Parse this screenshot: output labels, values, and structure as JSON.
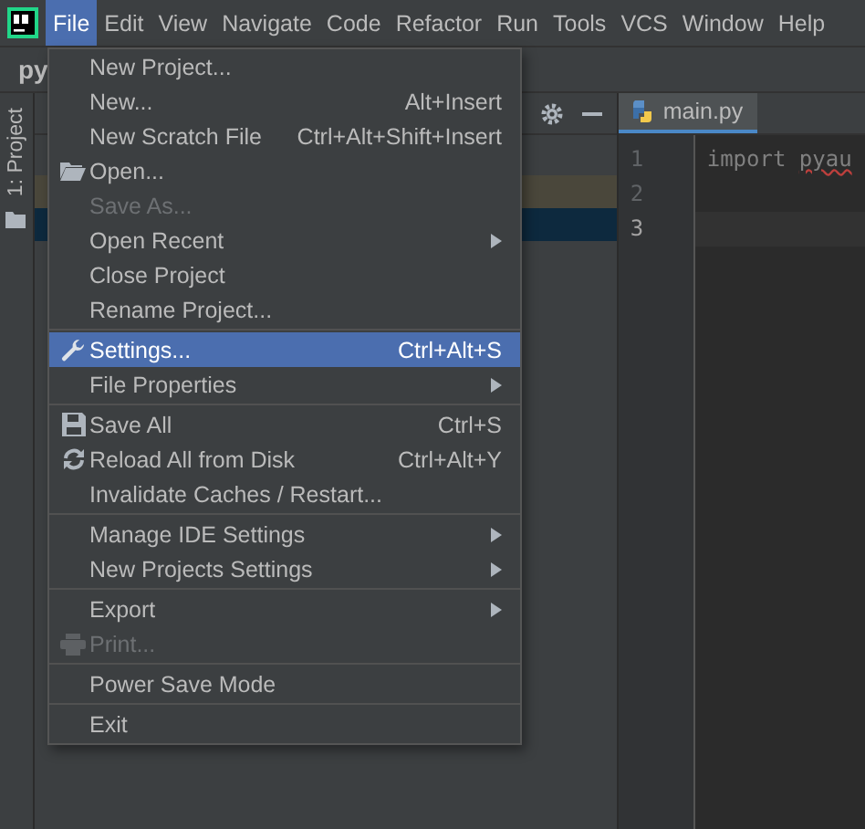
{
  "menubar": {
    "items": [
      {
        "label": "File",
        "selected": true
      },
      {
        "label": "Edit",
        "selected": false
      },
      {
        "label": "View",
        "selected": false
      },
      {
        "label": "Navigate",
        "selected": false
      },
      {
        "label": "Code",
        "selected": false
      },
      {
        "label": "Refactor",
        "selected": false
      },
      {
        "label": "Run",
        "selected": false
      },
      {
        "label": "Tools",
        "selected": false
      },
      {
        "label": "VCS",
        "selected": false
      },
      {
        "label": "Window",
        "selected": false
      },
      {
        "label": "Help",
        "selected": false
      }
    ]
  },
  "project_title": "py",
  "tool_window_tab": {
    "label": "1: Project"
  },
  "project_tree": {
    "rows": [
      {
        "highlighted": true,
        "selected": false
      },
      {
        "highlighted": false,
        "selected": true
      }
    ]
  },
  "editor": {
    "tab": {
      "label": "main.py",
      "selected": true
    },
    "lines": [
      {
        "number": "1",
        "current": false,
        "tokens": [
          {
            "text": "import",
            "error": false
          },
          {
            "text": "pyau",
            "error": true
          }
        ]
      },
      {
        "number": "2",
        "current": false
      },
      {
        "number": "3",
        "current": true
      }
    ]
  },
  "file_menu": {
    "items": [
      {
        "kind": "item",
        "label": "New Project...",
        "disabled": false,
        "selected": false,
        "submenu": false
      },
      {
        "kind": "item",
        "label": "New...",
        "shortcut": "Alt+Insert",
        "disabled": false,
        "selected": false,
        "submenu": false
      },
      {
        "kind": "item",
        "label": "New Scratch File",
        "shortcut": "Ctrl+Alt+Shift+Insert",
        "disabled": false,
        "selected": false,
        "submenu": false
      },
      {
        "kind": "item",
        "label": "Open...",
        "disabled": false,
        "selected": false,
        "submenu": false
      },
      {
        "kind": "item",
        "label": "Save As...",
        "disabled": true,
        "selected": false,
        "submenu": false
      },
      {
        "kind": "item",
        "label": "Open Recent",
        "disabled": false,
        "selected": false,
        "submenu": true
      },
      {
        "kind": "item",
        "label": "Close Project",
        "disabled": false,
        "selected": false,
        "submenu": false
      },
      {
        "kind": "item",
        "label": "Rename Project...",
        "disabled": false,
        "selected": false,
        "submenu": false
      },
      {
        "kind": "separator"
      },
      {
        "kind": "item",
        "label": "Settings...",
        "shortcut": "Ctrl+Alt+S",
        "disabled": false,
        "selected": true,
        "submenu": false
      },
      {
        "kind": "item",
        "label": "File Properties",
        "disabled": false,
        "selected": false,
        "submenu": true
      },
      {
        "kind": "separator"
      },
      {
        "kind": "item",
        "label": "Save All",
        "shortcut": "Ctrl+S",
        "disabled": false,
        "selected": false,
        "submenu": false
      },
      {
        "kind": "item",
        "label": "Reload All from Disk",
        "shortcut": "Ctrl+Alt+Y",
        "disabled": false,
        "selected": false,
        "submenu": false
      },
      {
        "kind": "item",
        "label": "Invalidate Caches / Restart...",
        "disabled": false,
        "selected": false,
        "submenu": false
      },
      {
        "kind": "separator"
      },
      {
        "kind": "item",
        "label": "Manage IDE Settings",
        "disabled": false,
        "selected": false,
        "submenu": true
      },
      {
        "kind": "item",
        "label": "New Projects Settings",
        "disabled": false,
        "selected": false,
        "submenu": true
      },
      {
        "kind": "separator"
      },
      {
        "kind": "item",
        "label": "Export",
        "disabled": false,
        "selected": false,
        "submenu": true
      },
      {
        "kind": "item",
        "label": "Print...",
        "disabled": true,
        "selected": false,
        "submenu": false
      },
      {
        "kind": "separator"
      },
      {
        "kind": "item",
        "label": "Power Save Mode",
        "disabled": false,
        "selected": false,
        "submenu": false
      },
      {
        "kind": "separator"
      },
      {
        "kind": "item",
        "label": "Exit",
        "disabled": false,
        "selected": false,
        "submenu": false
      }
    ]
  }
}
